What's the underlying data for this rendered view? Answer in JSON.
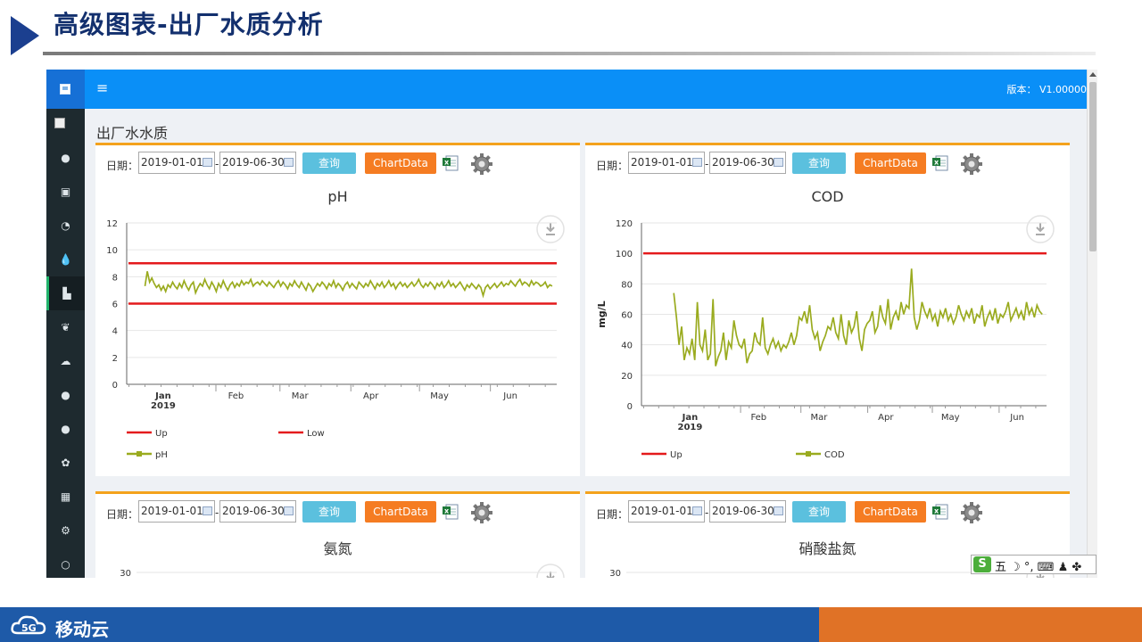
{
  "slide": {
    "title": "高级图表-出厂水质分析",
    "brand": "移动云"
  },
  "app": {
    "menu_icon": "≡",
    "version": "版本： V1.00000",
    "section_title": "出厂水水质",
    "sidebar_icons": [
      "globe-icon",
      "train-icon",
      "dashboard-icon",
      "drop-icon",
      "factory-icon",
      "leaf-icon",
      "cloud-icon",
      "globe-icon",
      "globe-icon",
      "cubes-icon",
      "calendar-icon",
      "cogs-icon",
      "circle-icon"
    ],
    "sidebar_glyphs": [
      "●",
      "▣",
      "◔",
      "💧",
      "▙",
      "❦",
      "☁",
      "●",
      "●",
      "✿",
      "▦",
      "⚙",
      "○"
    ]
  },
  "controls": {
    "date_label": "日期：",
    "start_date": "2019-01-01",
    "end_date": "2019-06-30",
    "dash": "-",
    "query_label": "查询",
    "chartdata_label": "ChartData"
  },
  "colors": {
    "topbar": "#0a8ff7",
    "limit_line": "#e41a1c",
    "series_line": "#9aab1f",
    "panel_border": "#f4a21d",
    "query_button": "#5bc0de",
    "chartdata_button": "#f57c22"
  },
  "ime": {
    "logo": "S",
    "text": "五 ☽ °, ⌨ ♟ ✤"
  },
  "chart_data": [
    {
      "type": "line",
      "title": "pH",
      "ylabel": "",
      "xlabel": "",
      "ylim": [
        0,
        12
      ],
      "yticks": [
        0,
        2,
        4,
        6,
        8,
        10,
        12
      ],
      "x_ticks": [
        {
          "label": "Jan",
          "sub": "2019",
          "day": 0
        },
        {
          "label": "Feb",
          "day": 31
        },
        {
          "label": "Mar",
          "day": 59
        },
        {
          "label": "Apr",
          "day": 90
        },
        {
          "label": "May",
          "day": 120
        },
        {
          "label": "Jun",
          "day": 151
        }
      ],
      "x_range_days": [
        -8,
        180
      ],
      "legend": [
        "Up",
        "Low",
        "pH"
      ],
      "legend_placement": "bottom",
      "series": [
        {
          "name": "Up",
          "constant": 9,
          "color": "#e41a1c"
        },
        {
          "name": "Low",
          "constant": 6,
          "color": "#e41a1c"
        },
        {
          "name": "pH",
          "color": "#9aab1f",
          "values": [
            7.3,
            8.4,
            7.6,
            7.9,
            7.5,
            7.2,
            7.4,
            7.0,
            7.3,
            6.9,
            7.4,
            7.2,
            7.6,
            7.3,
            7.1,
            7.5,
            7.2,
            7.7,
            7.3,
            7.0,
            7.4,
            7.6,
            6.8,
            7.2,
            7.5,
            7.3,
            7.8,
            7.4,
            7.1,
            7.6,
            7.3,
            6.9,
            7.5,
            7.2,
            7.7,
            7.3,
            7.0,
            7.4,
            7.6,
            7.2,
            7.5,
            7.3,
            7.7,
            7.4,
            7.6,
            7.5,
            7.8,
            7.3,
            7.5,
            7.6,
            7.4,
            7.7,
            7.5,
            7.3,
            7.6,
            7.4,
            7.2,
            7.5,
            7.7,
            7.3,
            7.6,
            7.4,
            7.1,
            7.5,
            7.3,
            7.7,
            7.4,
            7.2,
            7.6,
            7.3,
            7.0,
            7.5,
            7.3,
            6.9,
            7.2,
            7.5,
            7.3,
            7.6,
            7.4,
            7.1,
            7.5,
            7.3,
            7.7,
            7.2,
            7.5,
            7.3,
            7.0,
            7.4,
            7.6,
            7.2,
            7.5,
            7.3,
            7.1,
            7.6,
            7.4,
            7.2,
            7.5,
            7.3,
            7.7,
            7.4,
            7.1,
            7.5,
            7.3,
            7.6,
            7.2,
            7.4,
            7.7,
            7.3,
            7.5,
            7.1,
            7.4,
            7.6,
            7.3,
            7.5,
            7.2,
            7.4,
            7.6,
            7.3,
            7.5,
            7.8,
            7.4,
            7.2,
            7.5,
            7.3,
            7.6,
            7.4,
            7.1,
            7.5,
            7.3,
            7.6,
            7.2,
            7.4,
            7.7,
            7.3,
            7.5,
            7.2,
            7.4,
            7.6,
            7.3,
            7.0,
            7.4,
            7.2,
            7.5,
            7.3,
            7.1,
            7.4,
            7.2,
            6.6,
            7.2,
            7.4,
            7.1,
            7.3,
            7.5,
            7.2,
            7.4,
            7.6,
            7.3,
            7.5,
            7.4,
            7.7,
            7.5,
            7.3,
            7.6,
            7.8,
            7.4,
            7.6,
            7.5,
            7.3,
            7.7,
            7.4,
            7.6,
            7.5,
            7.3,
            7.4,
            7.6,
            7.2,
            7.4,
            7.3
          ]
        }
      ]
    },
    {
      "type": "line",
      "title": "COD",
      "ylabel": "mg/L",
      "xlabel": "",
      "ylim": [
        0,
        120
      ],
      "yticks": [
        0,
        20,
        40,
        60,
        80,
        100,
        120
      ],
      "x_ticks": [
        {
          "label": "Jan",
          "sub": "2019",
          "day": 0
        },
        {
          "label": "Feb",
          "day": 31
        },
        {
          "label": "Mar",
          "day": 59
        },
        {
          "label": "Apr",
          "day": 90
        },
        {
          "label": "May",
          "day": 120
        },
        {
          "label": "Jun",
          "day": 151
        }
      ],
      "x_range_days": [
        -15,
        173
      ],
      "legend": [
        "Up",
        "COD"
      ],
      "legend_placement": "bottom",
      "series": [
        {
          "name": "Up",
          "constant": 100,
          "color": "#e41a1c"
        },
        {
          "name": "COD",
          "color": "#9aab1f",
          "values": [
            74,
            58,
            40,
            52,
            30,
            38,
            34,
            44,
            30,
            68,
            40,
            36,
            50,
            30,
            34,
            70,
            26,
            32,
            36,
            48,
            30,
            42,
            38,
            56,
            46,
            40,
            38,
            44,
            28,
            34,
            36,
            48,
            42,
            40,
            58,
            38,
            34,
            40,
            44,
            38,
            42,
            36,
            40,
            38,
            42,
            48,
            40,
            46,
            58,
            56,
            62,
            54,
            66,
            50,
            44,
            48,
            36,
            42,
            46,
            52,
            50,
            58,
            48,
            44,
            60,
            46,
            40,
            56,
            48,
            52,
            62,
            44,
            36,
            50,
            54,
            56,
            62,
            48,
            52,
            66,
            58,
            54,
            70,
            50,
            58,
            62,
            56,
            68,
            60,
            66,
            64,
            90,
            58,
            50,
            56,
            68,
            62,
            58,
            64,
            56,
            60,
            52,
            62,
            58,
            64,
            56,
            60,
            54,
            58,
            66,
            60,
            56,
            62,
            58,
            64,
            54,
            60,
            58,
            66,
            52,
            58,
            62,
            56,
            64,
            54,
            60,
            58,
            62,
            68,
            56,
            60,
            64,
            58,
            62,
            56,
            68,
            60,
            64,
            58,
            66,
            62,
            60
          ]
        }
      ]
    },
    {
      "type": "line",
      "title": "氨氮",
      "ylim": [
        0,
        30
      ],
      "yticks_visible": [
        30
      ]
    },
    {
      "type": "line",
      "title": "硝酸盐氮",
      "ylim": [
        0,
        30
      ],
      "yticks_visible": [
        30
      ]
    }
  ]
}
